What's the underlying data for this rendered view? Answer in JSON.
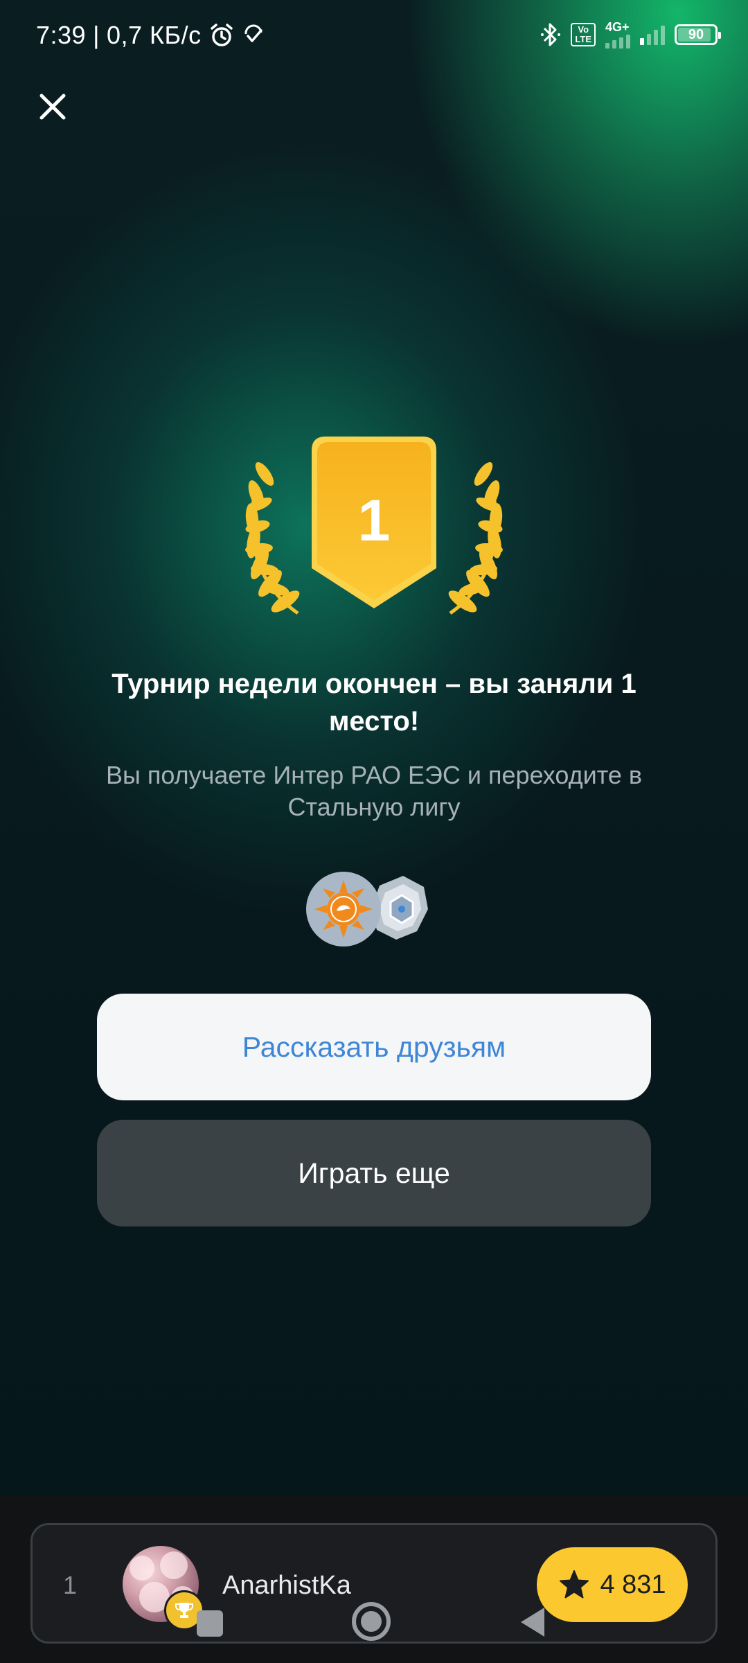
{
  "status_bar": {
    "time": "7:39",
    "separator": "|",
    "speed": "0,7 КБ/с",
    "network": "4G+",
    "volte_top": "Vo",
    "volte_bottom": "LTE",
    "battery": "90",
    "battery_level": 0.9
  },
  "medal": {
    "place": "1"
  },
  "result": {
    "title": "Турнир недели окончен – вы заняли 1 место!",
    "subtitle": "Вы получаете Интер РАО ЕЭС и переходите в Стальную лигу"
  },
  "buttons": {
    "share": "Рассказать друзьям",
    "play": "Играть еще"
  },
  "leaderboard": {
    "rows": [
      {
        "rank": "1",
        "name": "AnarhistKa",
        "score": "4 831"
      }
    ]
  },
  "colors": {
    "accent_blue": "#3f86d6",
    "gold": "#fbc92f",
    "dark_button": "#3b4246"
  },
  "icons": [
    "close-icon",
    "alarm-icon",
    "check-icon",
    "bluetooth-icon",
    "trophy-icon",
    "star-icon",
    "company-logo-icon",
    "league-icon"
  ]
}
